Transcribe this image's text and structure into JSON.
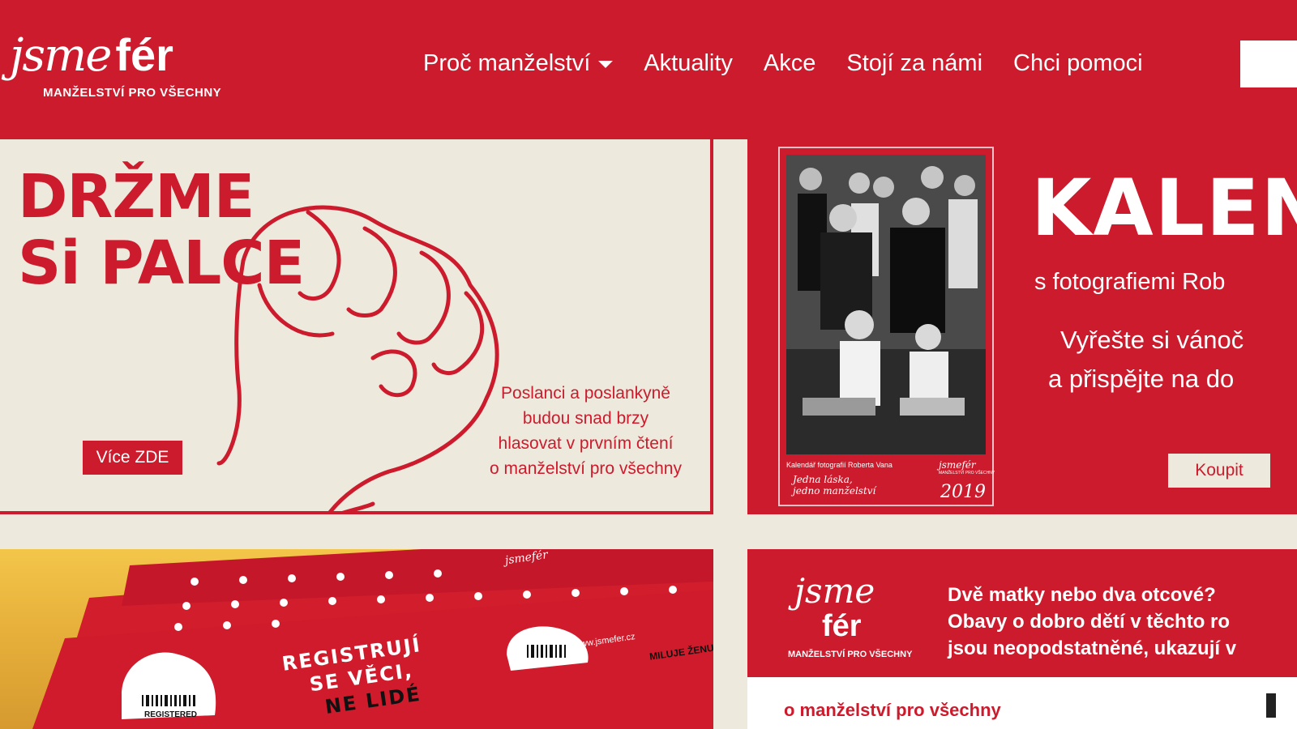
{
  "header": {
    "logo_script": "jsme",
    "logo_bold": "fér",
    "logo_tagline": "MANŽELSTVÍ PRO VŠECHNY",
    "nav": [
      {
        "label": "Proč manželství",
        "has_dropdown": true
      },
      {
        "label": "Aktuality"
      },
      {
        "label": "Akce"
      },
      {
        "label": "Stojí za námi"
      },
      {
        "label": "Chci pomoci"
      }
    ]
  },
  "hero_left": {
    "headline_line1": "DRŽME",
    "headline_line2": "Si PALCE",
    "button": "Více ZDE",
    "caption": [
      "Poslanci a poslankyně",
      "budou snad brzy",
      "hlasovat v prvním čtení",
      "o manželství pro všechny"
    ]
  },
  "hero_right": {
    "calendar_caption": "Kalendář fotografií Roberta Vana",
    "calendar_script_line1": "Jedna láska,",
    "calendar_script_line2": "jedno manželství",
    "calendar_logo": "jsmefér",
    "calendar_logo_tag": "MANŽELSTVÍ PRO VŠECHNY",
    "calendar_year": "2019",
    "title": "KALEN",
    "subtitle": "s fotografiemi Rob",
    "line1": "Vyřešte si vánoč",
    "line2": "a přispějte na do",
    "button": "Koupit"
  },
  "bottom_left": {
    "card_text_line1": "REGISTRUJÍ",
    "card_text_line2": "SE VĚCI,",
    "card_text_line3": "NE LIDÉ",
    "barcode_label": "REGISTERED",
    "card_url": "www.jsmefer.cz",
    "card_brand": "jsmefér",
    "card_edge_text": "MILUJE ŽENU"
  },
  "bottom_right": {
    "logo_script": "jsme",
    "logo_bold": "fér",
    "logo_tagline": "MANŽELSTVÍ PRO VŠECHNY",
    "text": [
      "Dvě matky nebo dva otcové?",
      "Obavy o dobro dětí v těchto ro",
      "jsou neopodstatněné, ukazují v"
    ],
    "bottom_text": "o manželství pro všechny"
  },
  "colors": {
    "brand_red": "#cc1b2c",
    "cream": "#ede9dd",
    "white": "#ffffff"
  }
}
